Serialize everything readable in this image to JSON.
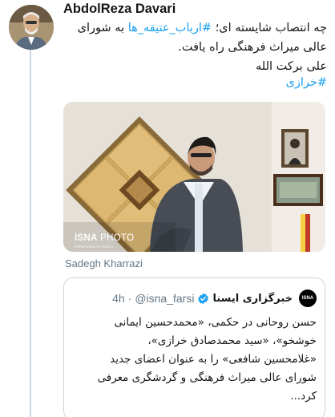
{
  "tweet": {
    "author_name": "AbdolReza Davari",
    "text_line1_a": "چه انتصاب شایسته ای؛ ",
    "text_line1_link": "#ارباب_عتیقه_ها",
    "text_line1_b": " به شورای",
    "text_line2": "عالی میراث فرهنگی راه یافت.",
    "text_line3": "علی برکت الله",
    "hashtag": "#خرازی",
    "photo_credit": "ISNA",
    "photo_credit_suffix": " PHOTO",
    "photographer": "Mohammadreza Nadimi",
    "caption": "Sadegh Kharrazi"
  },
  "quoted": {
    "avatar_label": "ISNA",
    "name": "خبرگزاری ایسنا",
    "handle": "@isna_farsi",
    "separator": "·",
    "time": "4h",
    "lines": [
      "حسن روحانی در حکمی، «محمدحسین ایمانی",
      "خوشخو»، «سید محمدصادق خرازی»،",
      "«غلامحسین شافعی» را به عنوان اعضای جدید",
      "شورای عالی میراث فرهنگی و گردشگری معرفی",
      "کرد..."
    ]
  },
  "colors": {
    "link": "#1da1f2",
    "secondary": "#657786",
    "border": "#ccd6dd",
    "verified": "#1da1f2"
  }
}
